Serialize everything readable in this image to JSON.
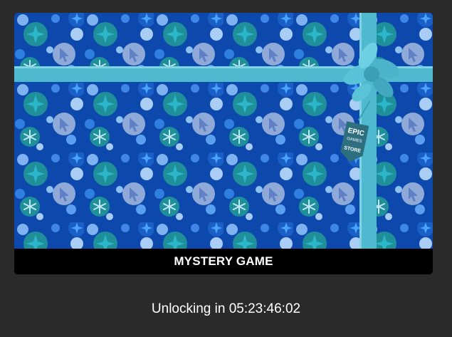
{
  "offer": {
    "title": "MYSTERY GAME",
    "status_prefix": "Unlocking in",
    "countdown": "05:23:46:02",
    "tag_text": [
      "EPIC",
      "GAMES",
      "STORE"
    ],
    "icons": {
      "pattern": "snowflake-star-cursor-pattern",
      "tag": "epic-games-store-tag-icon"
    }
  },
  "colors": {
    "background": "#2a2a2a",
    "wrap": "#0d49ad",
    "ribbon": "#4fb9d0",
    "caption_bg": "#000000",
    "text": "#ffffff"
  }
}
